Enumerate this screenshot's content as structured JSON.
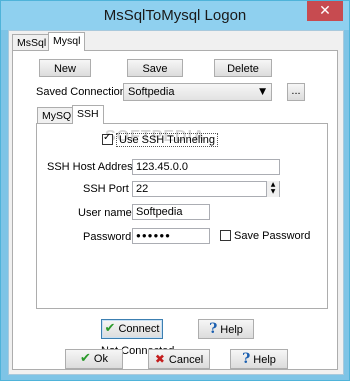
{
  "window": {
    "title": "MsSqlToMysql Logon",
    "close_glyph": "✕"
  },
  "outer_tabs": [
    {
      "label": "MsSql"
    },
    {
      "label": "Mysql"
    }
  ],
  "buttons": {
    "new": "New",
    "save": "Save",
    "delete": "Delete",
    "browse": "..."
  },
  "saved_connections": {
    "label": "Saved Connections",
    "value": "Softpedia"
  },
  "inner_tabs": [
    {
      "label": "MySQL"
    },
    {
      "label": "SSH"
    }
  ],
  "ssh": {
    "use_tunneling_label": "Use SSH Tunneling",
    "use_tunneling_checked": true,
    "host_label": "SSH Host Address",
    "host_value": "123.45.0.0",
    "port_label": "SSH Port",
    "port_value": "22",
    "user_label": "User name",
    "user_value": "Softpedia",
    "password_label": "Password",
    "password_value": "●●●●●●",
    "save_password_label": "Save Password",
    "save_password_checked": false
  },
  "watermark": "SOFTPEDIA",
  "connect": {
    "connect_label": "Connect",
    "help_label": "Help",
    "status": "Not Connected."
  },
  "footer": {
    "ok_label": "Ok",
    "cancel_label": "Cancel",
    "help_label": "Help"
  },
  "icons": {
    "connect": "check-icon",
    "ok": "check-icon",
    "cancel": "x-icon",
    "help": "question-icon"
  }
}
